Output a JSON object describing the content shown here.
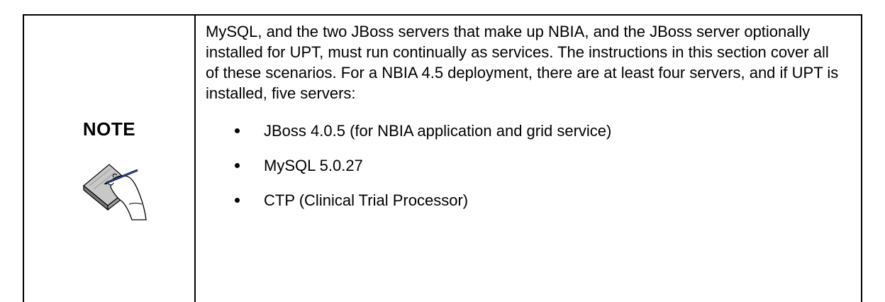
{
  "note": {
    "label": "NOTE",
    "icon": "hand-writing-on-notepad-icon"
  },
  "content": {
    "paragraph": "MySQL, and the two JBoss servers that make up NBIA, and the JBoss server optionally installed for UPT, must run continually as services. The instructions in this section cover all of these scenarios. For a NBIA 4.5 deployment, there are at least four servers, and if UPT is installed, five servers:",
    "bullets": [
      "JBoss 4.0.5 (for NBIA application and grid service)",
      "MySQL 5.0.27",
      "CTP (Clinical Trial Processor)"
    ]
  }
}
